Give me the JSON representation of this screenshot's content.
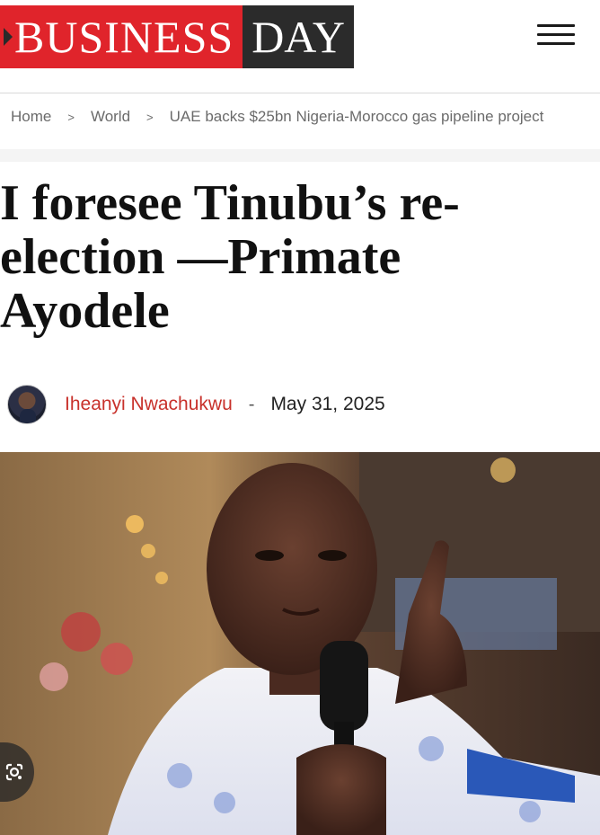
{
  "header": {
    "logo_part1": "BUSINESS",
    "logo_part2": "DAY",
    "menu_icon": "hamburger-menu-icon"
  },
  "breadcrumb": {
    "items": [
      "Home",
      "World",
      "UAE backs $25bn Nigeria-Morocco gas pipeline project"
    ],
    "separator": ">"
  },
  "article": {
    "title": "I foresee Tinubu’s re-election —Primate Ayodele",
    "author": "Iheanyi Nwachukwu",
    "separator": "-",
    "date": "May 31, 2025"
  },
  "colors": {
    "brand_red": "#e0242b",
    "brand_dark": "#2b2b2b",
    "author_red": "#c8312b"
  },
  "overlay": {
    "icon": "google-lens-icon"
  }
}
